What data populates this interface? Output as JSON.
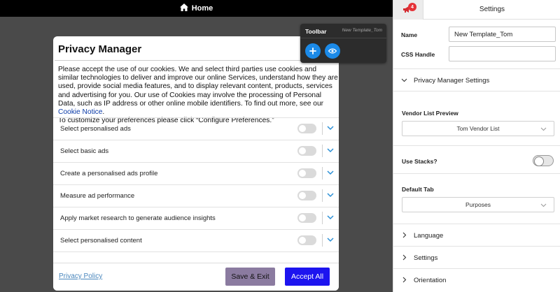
{
  "topbar": {
    "title": "Home",
    "icon": "home-icon"
  },
  "modal": {
    "title": "Privacy Manager",
    "body_text": "Please accept the use of our cookies. We and select third parties use cookies and similar technologies to deliver and improve our online Services, understand how they are used, provide social media features, and to display relevant content, products, services and advertising for you. Our use of Cookies may involve the processing of Personal Data, such as IP address or other online mobile identifiers. To find out more, see our ",
    "cookie_link": "Cookie Notice",
    "body_text_after": ".",
    "body_text_2": "To customize your preferences please click “Configure Preferences.”",
    "purposes": [
      {
        "label": "Select personalised ads",
        "enabled": false
      },
      {
        "label": "Select basic ads",
        "enabled": false
      },
      {
        "label": "Create a personalised ads profile",
        "enabled": false
      },
      {
        "label": "Measure ad performance",
        "enabled": false
      },
      {
        "label": "Apply market research to generate audience insights",
        "enabled": false
      },
      {
        "label": "Select personalised content",
        "enabled": false
      }
    ],
    "privacy_policy_link": "Privacy Policy",
    "save_exit_label": "Save & Exit",
    "accept_all_label": "Accept All",
    "colors": {
      "accept": "#1d14ef",
      "save": "#8b7ba0"
    }
  },
  "toolbar": {
    "title": "Toolbar",
    "template_name": "New Template_Tom",
    "add_icon": "plus-icon",
    "preview_icon": "eye-icon"
  },
  "panel": {
    "title": "Settings",
    "badge_count": "4",
    "name_label": "Name",
    "name_value": "New Template_Tom",
    "css_handle_label": "CSS Handle",
    "css_handle_value": "",
    "privacy_section": "Privacy Manager Settings",
    "vendor_list_label": "Vendor List Preview",
    "vendor_list_value": "Tom Vendor List",
    "use_stacks_label": "Use Stacks?",
    "use_stacks": false,
    "default_tab_label": "Default Tab",
    "default_tab_value": "Purposes",
    "sections": [
      "Language",
      "Settings",
      "Orientation"
    ]
  }
}
